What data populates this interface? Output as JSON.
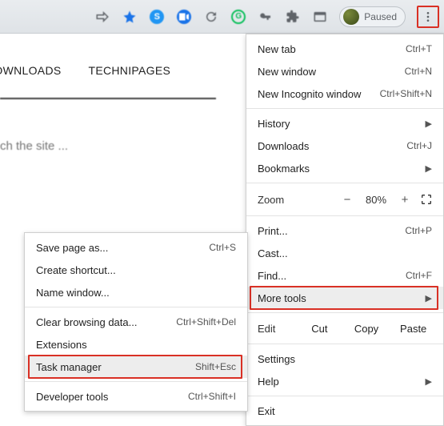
{
  "toolbar": {
    "paused_label": "Paused",
    "s_badge": "S"
  },
  "page": {
    "nav1": "DOWNLOADS",
    "nav2": "TECHNIPAGES",
    "search_placeholder": "ch the site ..."
  },
  "menu": {
    "new_tab": "New tab",
    "new_tab_sc": "Ctrl+T",
    "new_window": "New window",
    "new_window_sc": "Ctrl+N",
    "incognito": "New Incognito window",
    "incognito_sc": "Ctrl+Shift+N",
    "history": "History",
    "downloads": "Downloads",
    "downloads_sc": "Ctrl+J",
    "bookmarks": "Bookmarks",
    "zoom": "Zoom",
    "zoom_minus": "−",
    "zoom_pct": "80%",
    "zoom_plus": "+",
    "print": "Print...",
    "print_sc": "Ctrl+P",
    "cast": "Cast...",
    "find": "Find...",
    "find_sc": "Ctrl+F",
    "more_tools": "More tools",
    "edit": "Edit",
    "cut": "Cut",
    "copy": "Copy",
    "paste": "Paste",
    "settings": "Settings",
    "help": "Help",
    "exit": "Exit"
  },
  "submenu": {
    "save_page": "Save page as...",
    "save_page_sc": "Ctrl+S",
    "create_shortcut": "Create shortcut...",
    "name_window": "Name window...",
    "clear_data": "Clear browsing data...",
    "clear_data_sc": "Ctrl+Shift+Del",
    "extensions": "Extensions",
    "task_manager": "Task manager",
    "task_manager_sc": "Shift+Esc",
    "dev_tools": "Developer tools",
    "dev_tools_sc": "Ctrl+Shift+I"
  }
}
